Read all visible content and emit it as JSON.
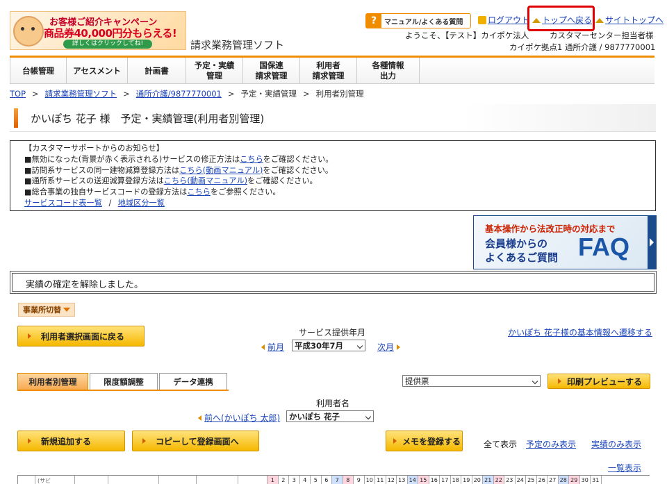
{
  "header": {
    "banner": {
      "line1": "お客様ご紹介キャンペーン",
      "line2": "商品券40,000円分もらえる!",
      "line3": "詳しくはクリックしてね!"
    },
    "app_title": "請求業務管理ソフト",
    "manual_button": "マニュアル/よくある質問",
    "logout": "ログアウト",
    "back_to_top": "トップへ戻る",
    "site_top": "サイトトップへ",
    "welcome": "ようこそ、【テスト】カイポケ法人",
    "staff": "カスタマーセンター担当者様",
    "office": "カイポケ拠点1 通所介護 / 9877770001"
  },
  "nav": [
    {
      "label": "台帳管理"
    },
    {
      "label": "アセスメント"
    },
    {
      "label": "計画書"
    },
    {
      "label": "予定・実績\n管理"
    },
    {
      "label": "国保連\n請求管理"
    },
    {
      "label": "利用者\n請求管理"
    },
    {
      "label": "各種情報\n出力"
    }
  ],
  "breadcrumb": {
    "top": "TOP",
    "soft": "請求業務管理ソフト",
    "office": "通所介護/9877770001",
    "plan": "予定・実績管理",
    "current": "利用者別管理"
  },
  "page_title": "かいぽち 花子 様　予定・実績管理(利用者別管理)",
  "notice": {
    "heading": "【カスタマーサポートからのお知らせ】",
    "items": [
      {
        "pre": "■無効になった(背景が赤く表示される)サービスの修正方法は",
        "link": "こちら",
        "post": "をご確認ください。"
      },
      {
        "pre": "■訪問系サービスの同一建物減算登録方法は",
        "link": "こちら(動画マニュアル)",
        "post": "をご確認ください。"
      },
      {
        "pre": "■通所系サービスの送迎減算登録方法は",
        "link": "こちら(動画マニュアル)",
        "post": "をご確認ください。"
      },
      {
        "pre": "■総合事業の独自サービスコードの登録方法は",
        "link": "こちら",
        "post": "をご参照ください。"
      }
    ],
    "service_code_link": "サービスコード表一覧",
    "separator": "/",
    "region_link": "地域区分一覧"
  },
  "faq_banner": {
    "line1": "基本操作から法改正時の対応まで",
    "line2": "会員様からの",
    "line3": "よくあるご質問",
    "big": "FAQ"
  },
  "message": "実績の確定を解除しました。",
  "office_switch": "事業所切替",
  "back_select_button": "利用者選択画面に戻る",
  "month": {
    "label": "サービス提供年月",
    "prev": "前月",
    "selected": "平成30年7月",
    "next": "次月"
  },
  "basic_info_link": "かいぽち 花子様の基本情報へ遷移する",
  "tabs": [
    {
      "label": "利用者別管理",
      "active": true
    },
    {
      "label": "限度額調整",
      "active": false
    },
    {
      "label": "データ連携",
      "active": false
    }
  ],
  "doc_select": "提供票",
  "print_button": "印刷プレビューする",
  "user": {
    "label": "利用者名",
    "prev": "前へ(かいぽち 太郎)",
    "selected": "かいぽち 花子"
  },
  "actions": {
    "add": "新規追加する",
    "copy": "コピーして登録画面へ",
    "memo": "メモを登録する",
    "show_all": "全て表示",
    "show_planned": "予定のみ表示",
    "show_actual": "実績のみ表示",
    "list_view": "一覧表示"
  },
  "grid": {
    "abbr": "(サビ",
    "days": [
      "1",
      "2",
      "3",
      "4",
      "5",
      "6",
      "7",
      "8",
      "9",
      "10",
      "11",
      "12",
      "13",
      "14",
      "15",
      "16",
      "17",
      "18",
      "19",
      "20",
      "21",
      "22",
      "23",
      "24",
      "25",
      "26",
      "27",
      "28",
      "29",
      "30",
      "31"
    ],
    "weekend_colors": {
      "sat": "#cfe0ff",
      "sun": "#ffd6e0"
    }
  },
  "colors": {
    "accent": "#f08c00",
    "link": "#1a44b8",
    "highlight": "#e00000"
  }
}
